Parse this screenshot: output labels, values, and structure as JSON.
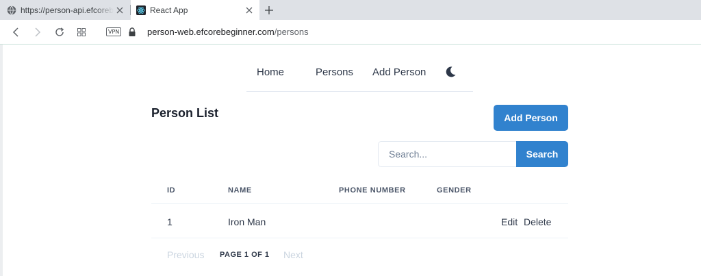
{
  "browser": {
    "tabs": [
      {
        "title": "https://person-api.efcorebeginner.com",
        "icon": "globe-icon",
        "active": false
      },
      {
        "title": "React App",
        "icon": "react-icon",
        "active": true
      }
    ],
    "vpn_label": "VPN",
    "url_host": "person-web.efcorebeginner.com",
    "url_path": "/persons"
  },
  "nav": {
    "items": [
      "Home",
      "Persons",
      "Add Person"
    ],
    "theme_icon": "moon-icon"
  },
  "page": {
    "title": "Person List",
    "add_button": "Add Person",
    "search_placeholder": "Search...",
    "search_value": "",
    "search_button": "Search"
  },
  "table": {
    "headers": [
      "ID",
      "NAME",
      "PHONE NUMBER",
      "GENDER"
    ],
    "rows": [
      {
        "id": "1",
        "name": "Iron Man",
        "phone": "",
        "gender": ""
      }
    ],
    "actions": [
      "Edit",
      "Delete"
    ]
  },
  "pagination": {
    "previous": "Previous",
    "info": "PAGE 1 OF 1",
    "next": "Next"
  },
  "colors": {
    "accent": "#3182ce",
    "disabled_text": "#cbd5e0"
  }
}
